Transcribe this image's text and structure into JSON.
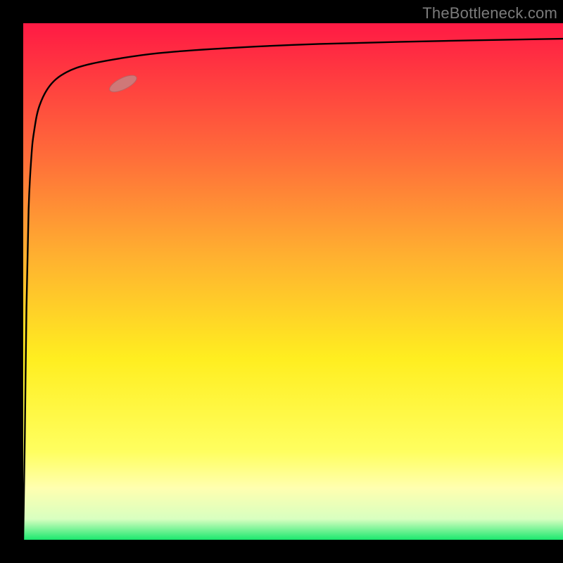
{
  "attribution": "TheBottleneck.com",
  "colors": {
    "frame": "#000000",
    "attribution_text": "#7b7b7b",
    "gradient_top": "#ff1a44",
    "gradient_upper_mid": "#ff6a3a",
    "gradient_mid": "#ffb030",
    "gradient_lower_mid": "#ffee20",
    "gradient_lower": "#ffffb0",
    "gradient_bottom": "#1be86e",
    "curve_stroke": "#000000",
    "marker_fill": "#c98080",
    "marker_stroke": "#b06868"
  },
  "chart_data": {
    "type": "line",
    "title": "",
    "xlabel": "",
    "ylabel": "",
    "xlim": [
      0,
      100
    ],
    "ylim": [
      0,
      100
    ],
    "series": [
      {
        "name": "curve",
        "x": [
          0,
          0.3,
          0.6,
          1,
          1.5,
          2,
          3,
          5,
          8,
          12,
          18,
          25,
          35,
          50,
          70,
          100
        ],
        "values": [
          0,
          20,
          45,
          64,
          74,
          79,
          84,
          88,
          90.5,
          92,
          93.2,
          94.2,
          95,
          95.8,
          96.4,
          97
        ]
      }
    ],
    "marker": {
      "x": 18.5,
      "y": 88.3,
      "angle_deg": -26
    },
    "gradient_stops_pct": [
      0,
      25,
      45,
      65,
      83,
      90,
      96,
      100
    ]
  }
}
